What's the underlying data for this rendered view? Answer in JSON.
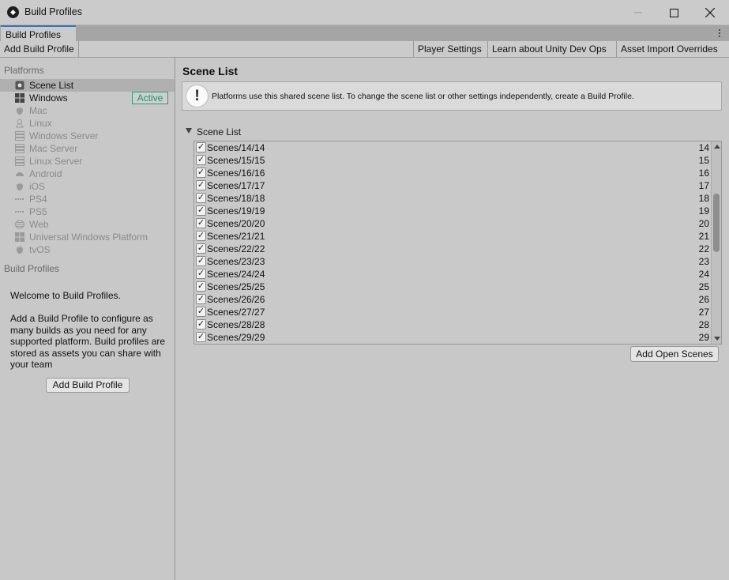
{
  "window": {
    "title": "Build Profiles",
    "icon": "unity-logo-icon"
  },
  "tab": {
    "label": "Build Profiles"
  },
  "toolbar": {
    "add_build_profile": "Add Build Profile",
    "player_settings": "Player Settings",
    "learn_dev_ops": "Learn about Unity Dev Ops",
    "asset_import_overrides": "Asset Import Overrides"
  },
  "sidebar": {
    "platforms_label": "Platforms",
    "platforms": [
      {
        "label": "Scene List",
        "icon": "scene-list-icon",
        "selected": true,
        "enabled": true
      },
      {
        "label": "Windows",
        "icon": "windows-icon",
        "enabled": true,
        "badge": "Active"
      },
      {
        "label": "Mac",
        "icon": "apple-icon",
        "enabled": false
      },
      {
        "label": "Linux",
        "icon": "linux-icon",
        "enabled": false
      },
      {
        "label": "Windows Server",
        "icon": "server-icon",
        "enabled": false
      },
      {
        "label": "Mac Server",
        "icon": "server-icon",
        "enabled": false
      },
      {
        "label": "Linux Server",
        "icon": "server-icon",
        "enabled": false
      },
      {
        "label": "Android",
        "icon": "android-icon",
        "enabled": false
      },
      {
        "label": "iOS",
        "icon": "apple-icon",
        "enabled": false
      },
      {
        "label": "PS4",
        "icon": "ps4-icon",
        "enabled": false
      },
      {
        "label": "PS5",
        "icon": "ps5-icon",
        "enabled": false
      },
      {
        "label": "Web",
        "icon": "web-icon",
        "enabled": false
      },
      {
        "label": "Universal Windows Platform",
        "icon": "windows-icon",
        "enabled": false
      },
      {
        "label": "tvOS",
        "icon": "apple-icon",
        "enabled": false
      }
    ],
    "build_profiles_label": "Build Profiles",
    "welcome_title": "Welcome to Build Profiles.",
    "welcome_body": "Add a Build Profile to configure as many builds as you need for any supported platform. Build profiles are stored as assets you can share with your team",
    "add_build_profile_button": "Add Build Profile"
  },
  "main": {
    "title": "Scene List",
    "info_text": "Platforms use this shared scene list. To change the scene list or other settings independently, create a Build Profile.",
    "foldout_label": "Scene List",
    "scenes": [
      {
        "name": "Scenes/14/14",
        "index": "14",
        "checked": true
      },
      {
        "name": "Scenes/15/15",
        "index": "15",
        "checked": true
      },
      {
        "name": "Scenes/16/16",
        "index": "16",
        "checked": true
      },
      {
        "name": "Scenes/17/17",
        "index": "17",
        "checked": true
      },
      {
        "name": "Scenes/18/18",
        "index": "18",
        "checked": true
      },
      {
        "name": "Scenes/19/19",
        "index": "19",
        "checked": true
      },
      {
        "name": "Scenes/20/20",
        "index": "20",
        "checked": true
      },
      {
        "name": "Scenes/21/21",
        "index": "21",
        "checked": true
      },
      {
        "name": "Scenes/22/22",
        "index": "22",
        "checked": true
      },
      {
        "name": "Scenes/23/23",
        "index": "23",
        "checked": true
      },
      {
        "name": "Scenes/24/24",
        "index": "24",
        "checked": true
      },
      {
        "name": "Scenes/25/25",
        "index": "25",
        "checked": true
      },
      {
        "name": "Scenes/26/26",
        "index": "26",
        "checked": true
      },
      {
        "name": "Scenes/27/27",
        "index": "27",
        "checked": true
      },
      {
        "name": "Scenes/28/28",
        "index": "28",
        "checked": true
      },
      {
        "name": "Scenes/29/29",
        "index": "29",
        "checked": true
      }
    ],
    "add_open_scenes_button": "Add Open Scenes"
  },
  "colors": {
    "accent_tab": "#3a72b0",
    "active_badge": "#20916c",
    "background": "#c8c8c8"
  }
}
